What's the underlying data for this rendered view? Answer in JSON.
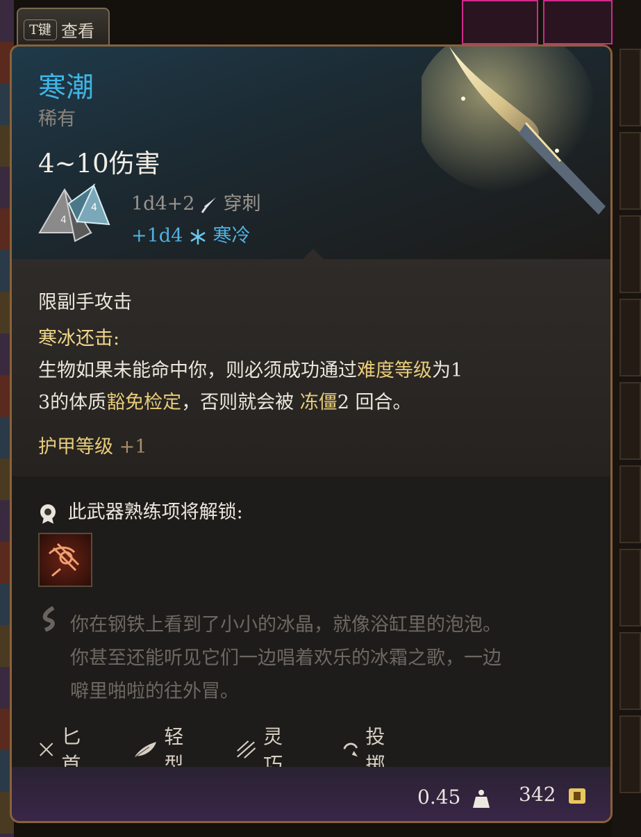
{
  "tab": {
    "key": "T键",
    "label": "查看"
  },
  "item": {
    "name": "寒潮",
    "rarity": "稀有",
    "damage_total": "4~10伤害",
    "damage_base": "1d4+2",
    "damage_base_type": "穿刺",
    "damage_bonus": "+1d4",
    "damage_bonus_type": "寒冷"
  },
  "description": {
    "offhand": "限副手攻击",
    "ability_title": "寒冰还击:",
    "ability_line1_a": "生物如果未能命中你，则必须成功通过",
    "ability_line1_b": "难度等级",
    "ability_line1_c": "为1",
    "ability_line2_a": "3的体质",
    "ability_line2_b": "豁免检定",
    "ability_line2_c": "，否则就会被 ",
    "ability_line2_d": "冻僵",
    "ability_line2_e": "2 回合。",
    "armor_label": "护甲等级",
    "armor_value": "+1"
  },
  "proficiency": {
    "label": "此武器熟练项将解锁:"
  },
  "flavor": [
    "你在钢铁上看到了小小的冰晶，就像浴缸里的泡泡。",
    "你甚至还能听见它们一边唱着欢乐的冰霜之歌，一边",
    "噼里啪啦的往外冒。"
  ],
  "tags": [
    "匕首",
    "轻型",
    "灵巧",
    "投掷"
  ],
  "footer": {
    "weight": "0.45",
    "price": "342"
  },
  "icons": {
    "dice": "dice-icon",
    "piercing": "dagger-pierce-icon",
    "cold": "snowflake-icon",
    "proficiency": "proficiency-badge-icon",
    "passive": "cold-retort-icon",
    "flavor": "quill-icon",
    "dagger": "crossed-daggers-icon",
    "light": "feather-icon",
    "finesse": "finesse-icon",
    "thrown": "thrown-icon",
    "weight": "weight-icon",
    "gold": "gold-coin-icon"
  },
  "colors": {
    "title": "#3fb4e4",
    "cold": "#4fb2e0",
    "highlight": "#e8cc7a",
    "border": "#8a6238"
  }
}
